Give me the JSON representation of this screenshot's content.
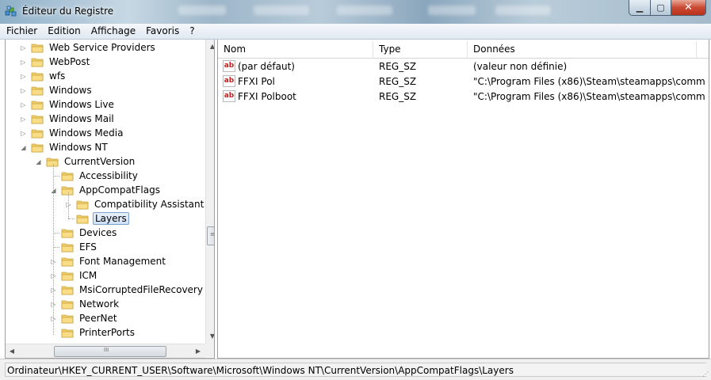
{
  "window": {
    "title": "Éditeur du Registre"
  },
  "menu": [
    "Fichier",
    "Edition",
    "Affichage",
    "Favoris",
    "?"
  ],
  "tree": {
    "items": [
      {
        "label": "Web Service Providers",
        "level": 1,
        "expander": "right"
      },
      {
        "label": "WebPost",
        "level": 1,
        "expander": "right"
      },
      {
        "label": "wfs",
        "level": 1,
        "expander": "right"
      },
      {
        "label": "Windows",
        "level": 1,
        "expander": "right"
      },
      {
        "label": "Windows Live",
        "level": 1,
        "expander": "right"
      },
      {
        "label": "Windows Mail",
        "level": 1,
        "expander": "right"
      },
      {
        "label": "Windows Media",
        "level": 1,
        "expander": "right"
      },
      {
        "label": "Windows NT",
        "level": 1,
        "expander": "down"
      },
      {
        "label": "CurrentVersion",
        "level": 2,
        "expander": "down"
      },
      {
        "label": "Accessibility",
        "level": 3,
        "expander": "none"
      },
      {
        "label": "AppCompatFlags",
        "level": 3,
        "expander": "down"
      },
      {
        "label": "Compatibility Assistant",
        "level": 4,
        "expander": "right"
      },
      {
        "label": "Layers",
        "level": 4,
        "expander": "none",
        "selected": true
      },
      {
        "label": "Devices",
        "level": 3,
        "expander": "none"
      },
      {
        "label": "EFS",
        "level": 3,
        "expander": "none"
      },
      {
        "label": "Font Management",
        "level": 3,
        "expander": "right"
      },
      {
        "label": "ICM",
        "level": 3,
        "expander": "right"
      },
      {
        "label": "MsiCorruptedFileRecovery",
        "level": 3,
        "expander": "right"
      },
      {
        "label": "Network",
        "level": 3,
        "expander": "right"
      },
      {
        "label": "PeerNet",
        "level": 3,
        "expander": "right"
      },
      {
        "label": "PrinterPorts",
        "level": 3,
        "expander": "none"
      }
    ],
    "scroll_thumb_grip": "≡",
    "hscroll_thumb_grip": "III"
  },
  "list": {
    "columns": [
      "Nom",
      "Type",
      "Données"
    ],
    "icon_text": "ab",
    "rows": [
      {
        "name": "(par défaut)",
        "type": "REG_SZ",
        "data": "(valeur non définie)"
      },
      {
        "name": "FFXI Pol",
        "type": "REG_SZ",
        "data": "\"C:\\Program Files (x86)\\Steam\\steamapps\\comm..."
      },
      {
        "name": "FFXI Polboot",
        "type": "REG_SZ",
        "data": "\"C:\\Program Files (x86)\\Steam\\steamapps\\comm..."
      }
    ]
  },
  "status": {
    "path": "Ordinateur\\HKEY_CURRENT_USER\\Software\\Microsoft\\Windows NT\\CurrentVersion\\AppCompatFlags\\Layers"
  },
  "colors": {
    "folder": "#f2cf6b",
    "selection": "#cfe2f6",
    "close_button": "#c94a33"
  }
}
